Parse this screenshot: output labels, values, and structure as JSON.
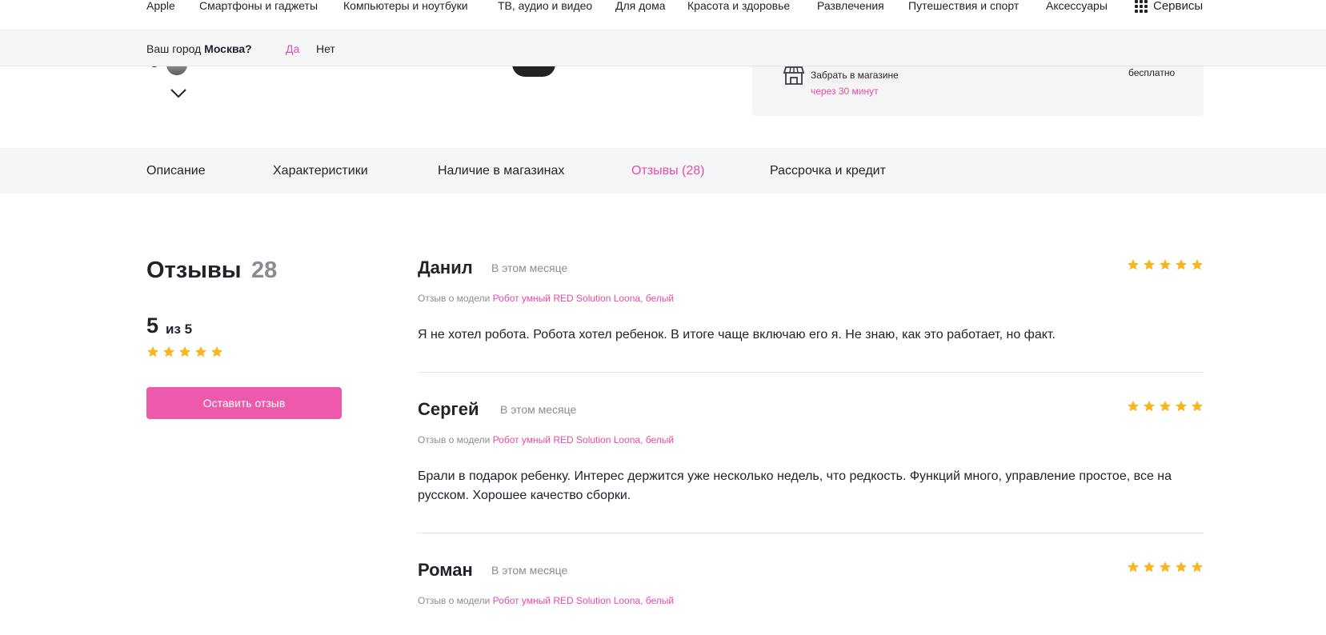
{
  "topnav": {
    "items": [
      "Apple",
      "Смартфоны и гаджеты",
      "Компьютеры и ноутбуки",
      "ТВ, аудио и видео",
      "Для дома",
      "Красота и здоровье",
      "Развлечения",
      "Путешествия и спорт",
      "Аксессуары"
    ],
    "services_label": "Сервисы",
    "services_icon": "grid-icon"
  },
  "citybar": {
    "question_prefix": "Ваш город",
    "city": "Москва?",
    "yes_label": "Да",
    "no_label": "Нет"
  },
  "delivery": {
    "pickup_title": "Забрать в магазине",
    "pickup_time": "через 30 минут",
    "free_label": "бесплатно",
    "icon": "store-icon"
  },
  "tabs": [
    {
      "label": "Описание",
      "active": false
    },
    {
      "label": "Характеристики",
      "active": false
    },
    {
      "label": "Наличие в магазинах",
      "active": false
    },
    {
      "label": "Отзывы (28)",
      "active": true
    },
    {
      "label": "Рассрочка и кредит",
      "active": false
    }
  ],
  "reviews_summary": {
    "title": "Отзывы",
    "count": "28",
    "rating": "5",
    "rating_of": "из 5",
    "stars": 5,
    "leave_button": "Оставить отзыв"
  },
  "reviews": [
    {
      "author": "Данил",
      "date": "В этом месяце",
      "stars": 5,
      "model_prefix": "Отзыв о модели",
      "model_link": "Робот умный RED Solution Loona, белый",
      "text": "Я не хотел робота. Робота хотел ребенок. В итоге чаще включаю его я. Не знаю, как это работает, но факт."
    },
    {
      "author": "Сергей",
      "date": "В этом месяце",
      "stars": 5,
      "model_prefix": "Отзыв о модели",
      "model_link": "Робот умный RED Solution Loona, белый",
      "text": "Брали в подарок ребенку. Интерес держится уже несколько недель, что редкость. Функций много, управление простое, все на русском. Хорошее качество сборки."
    },
    {
      "author": "Роман",
      "date": "В этом месяце",
      "stars": 5,
      "model_prefix": "Отзыв о модели",
      "model_link": "Робот умный RED Solution Loona, белый",
      "text": ""
    }
  ],
  "colors": {
    "accent": "#e84ba3",
    "button": "#ee5aab",
    "star": "#f5b622",
    "muted": "#8b8b94",
    "panel": "#f6f6f9"
  }
}
